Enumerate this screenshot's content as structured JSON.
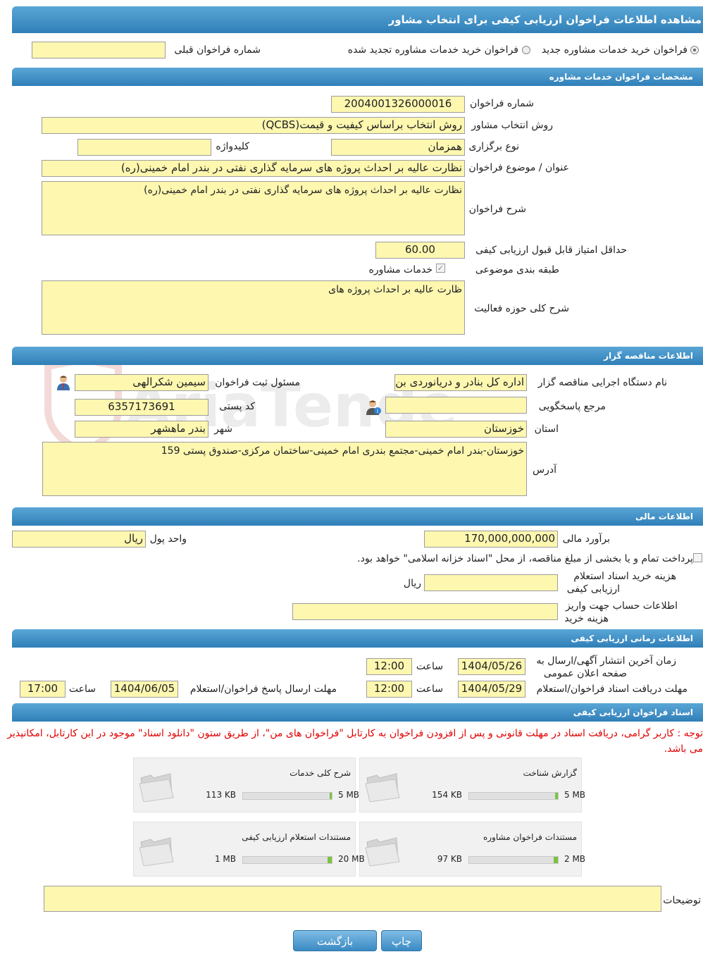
{
  "page": {
    "title": "مشاهده اطلاعات فراخوان ارزیابی کیفی برای انتخاب مشاور"
  },
  "top_options": {
    "radio_new": "فراخوان خرید خدمات مشاوره جدید",
    "radio_renewed": "فراخوان خرید خدمات مشاوره تجدید شده",
    "prev_number_label": "شماره فراخوان قبلی",
    "prev_number_value": ""
  },
  "sections": {
    "consulting": "مشخصات فراخوان خدمات مشاوره",
    "tenderer": "اطلاعات مناقصه گزار",
    "financial": "اطلاعات مالی",
    "timing": "اطلاعات زمانی ارزیابی کیفی",
    "documents": "اسناد فراخوان ارزیابی کیفی"
  },
  "consulting": {
    "number_label": "شماره فراخوان",
    "number_value": "2004001326000016",
    "method_label": "روش انتخاب مشاور",
    "method_value": "روش انتخاب براساس کیفیت و قیمت(QCBS)",
    "type_label": "نوع برگزاری",
    "type_value": "همزمان",
    "keyword_label": "کلیدواژه",
    "keyword_value": "",
    "subject_label": "عنوان / موضوع فراخوان",
    "subject_value": "نظارت عالیه بر احداث پروژه های سرمایه گذاری نفتی در بندر  امام خمینی(ره)",
    "desc_label": "شرح فراخوان",
    "desc_value": "نظارت عالیه بر احداث پروژه های سرمایه گذاری نفتی در بندر  امام خمینی(ره)",
    "min_score_label": "حداقل امتیاز قابل قبول ارزیابی کیفی",
    "min_score_value": "60.00",
    "category_label": "طبقه بندی موضوعی",
    "category_value": "خدمات مشاوره",
    "scope_label": "شرح کلی حوزه فعالیت",
    "scope_value": "ظارت عالیه بر احداث پروژه های"
  },
  "tenderer": {
    "org_label": "نام دستگاه اجرایی مناقصه گزار",
    "org_value": "اداره کل بنادر و دریانوردی بن",
    "registrar_label": "مسئول ثبت فراخوان",
    "registrar_value": "سیمین شکرالهی",
    "reference_label": "مرجع پاسخگویی",
    "reference_value": "",
    "postal_label": "کد پستی",
    "postal_value": "6357173691",
    "province_label": "استان",
    "province_value": "خوزستان",
    "city_label": "شهر",
    "city_value": "بندر ماهشهر",
    "address_label": "آدرس",
    "address_value": "خوزستان-بندر امام خمینی-مجتمع بندری امام خمینی-ساختمان مرکزی-صندوق پستی 159"
  },
  "financial": {
    "estimate_label": "برآورد مالی",
    "estimate_value": "170,000,000,000",
    "currency_label": "واحد پول",
    "currency_value": "ریال",
    "treasury_text": "پرداخت تمام و یا بخشی از مبلغ مناقصه، از محل \"اسناد خزانه اسلامی\" خواهد بود.",
    "doc_cost_label_1": "هزینه خرید اسناد استعلام",
    "doc_cost_label_2": "ارزیابی کیفی",
    "doc_cost_value": "",
    "doc_cost_unit": "ریال",
    "account_label_1": "اطلاعات حساب جهت واریز",
    "account_label_2": "هزینه خرید",
    "account_value": ""
  },
  "timing": {
    "publish_label_1": "زمان آخرین انتشار آگهی/ارسال به",
    "publish_label_2": "صفحه اعلان عمومی",
    "publish_date": "1404/05/26",
    "publish_time": "12:00",
    "time_label": "ساعت",
    "receive_label": "مهلت دریافت اسناد فراخوان/استعلام",
    "receive_date": "1404/05/29",
    "receive_time": "12:00",
    "submit_label": "مهلت ارسال پاسخ فراخوان/استعلام",
    "submit_date": "1404/06/05",
    "submit_time": "17:00"
  },
  "documents": {
    "note": "توجه : کاربر گرامی، دریافت اسناد در مهلت قانونی و پس از افزودن فراخوان به کارتابل \"فراخوان های من\"، از طریق ستون \"دانلود اسناد\" موجود در این کارتابل، امکانپذیر می باشد.",
    "files": [
      {
        "title": "گزارش شناخت",
        "used": "154 KB",
        "max": "5 MB",
        "fraction": 0.03
      },
      {
        "title": "شرح کلی خدمات",
        "used": "113 KB",
        "max": "5 MB",
        "fraction": 0.022
      },
      {
        "title": "مستندات فراخوان مشاوره",
        "used": "97 KB",
        "max": "2 MB",
        "fraction": 0.047
      },
      {
        "title": "مستندات استعلام ارزیابی کیفی",
        "used": "1 MB",
        "max": "20 MB",
        "fraction": 0.05
      }
    ],
    "notes_label": "توضیحات",
    "notes_value": ""
  },
  "buttons": {
    "print": "چاپ",
    "back": "بازگشت"
  },
  "watermark": "AriaTender.neT",
  "colors": {
    "header": "#3a8ac4",
    "field_bg": "#fdf7b0",
    "note": "#e00000",
    "bar_fill": "#7cc243"
  }
}
